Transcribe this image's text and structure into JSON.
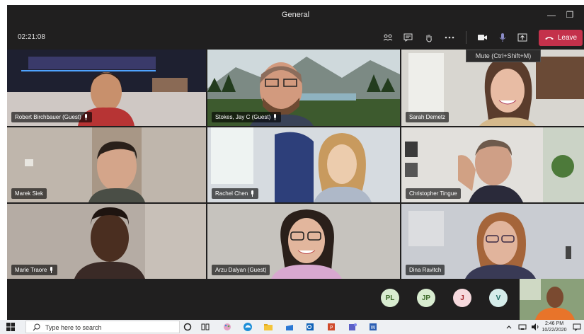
{
  "window": {
    "title": "General",
    "minimize": "—",
    "maximize": "❐"
  },
  "toolbar": {
    "timer": "02:21:08",
    "leave_label": "Leave",
    "mute_tooltip": "Mute (Ctrl+Shift+M)",
    "icons": [
      "participants-icon",
      "chat-icon",
      "raise-hand-icon",
      "more-icon",
      "camera-icon",
      "microphone-icon",
      "share-icon"
    ]
  },
  "participants": [
    {
      "name": "Robert Birchbauer (Guest)",
      "mic_icon": true
    },
    {
      "name": "Stokes, Jay C (Guest)",
      "mic_icon": true
    },
    {
      "name": "Sarah Demetz",
      "mic_icon": false
    },
    {
      "name": "Marek Siek",
      "mic_icon": false
    },
    {
      "name": "Rachel Chen",
      "mic_icon": true
    },
    {
      "name": "Christopher Tingue",
      "mic_icon": false
    },
    {
      "name": "Marie Traore",
      "mic_icon": true
    },
    {
      "name": "Arzu Dalyan (Guest)",
      "mic_icon": false
    },
    {
      "name": "Dina Ravitch",
      "mic_icon": false
    }
  ],
  "avatars": [
    {
      "initials": "PL",
      "bg": "#d8ecd0",
      "fg": "#3d6b2a"
    },
    {
      "initials": "JP",
      "bg": "#d8ecd0",
      "fg": "#3d6b2a"
    },
    {
      "initials": "J",
      "bg": "#f6d9dd",
      "fg": "#a4262c"
    },
    {
      "initials": "V",
      "bg": "#d5ecea",
      "fg": "#1f6b66"
    }
  ],
  "taskbar": {
    "search_placeholder": "Type here to search",
    "time": "2:46 PM",
    "date": "10/22/2020"
  },
  "colors": {
    "accent_leave": "#c4314b",
    "app_bg": "#201f1f"
  }
}
